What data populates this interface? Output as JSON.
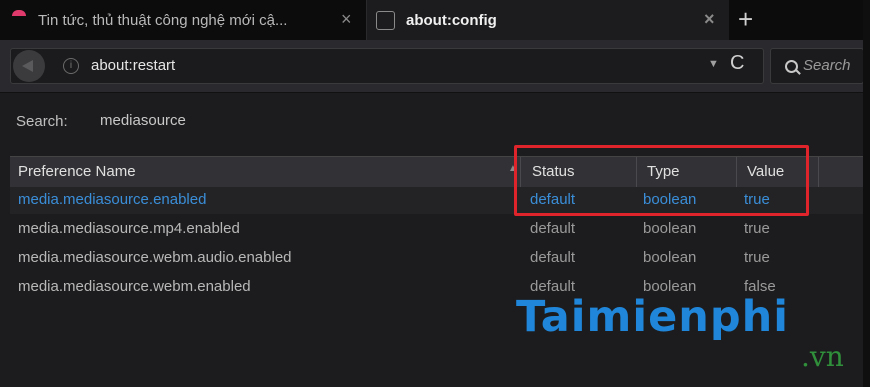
{
  "tabs": [
    {
      "title": "Tin tức, thủ thuật công nghệ mới cậ...",
      "close": "×"
    },
    {
      "title": "about:config",
      "close": "×"
    }
  ],
  "new_tab": "+",
  "navbar": {
    "url": "about:restart",
    "reload": "C",
    "dropdown": "▼",
    "search_placeholder": "Search",
    "info": "i"
  },
  "filter": {
    "label": "Search:",
    "value": "mediasource"
  },
  "table": {
    "headers": {
      "name": "Preference Name",
      "status": "Status",
      "type": "Type",
      "value": "Value"
    },
    "sort_indicator": "▲",
    "rows": [
      {
        "name": "media.mediasource.enabled",
        "status": "default",
        "type": "boolean",
        "value": "true"
      },
      {
        "name": "media.mediasource.mp4.enabled",
        "status": "default",
        "type": "boolean",
        "value": "true"
      },
      {
        "name": "media.mediasource.webm.audio.enabled",
        "status": "default",
        "type": "boolean",
        "value": "true"
      },
      {
        "name": "media.mediasource.webm.enabled",
        "status": "default",
        "type": "boolean",
        "value": "false"
      }
    ]
  },
  "watermark": {
    "brand": "Taimienphi",
    "tld": ".vn"
  },
  "colors": {
    "highlight_box": "#e0242c",
    "selected_text": "#3a8ed8",
    "watermark_blue": "#1f86d9",
    "watermark_green": "#2f8f3a"
  }
}
